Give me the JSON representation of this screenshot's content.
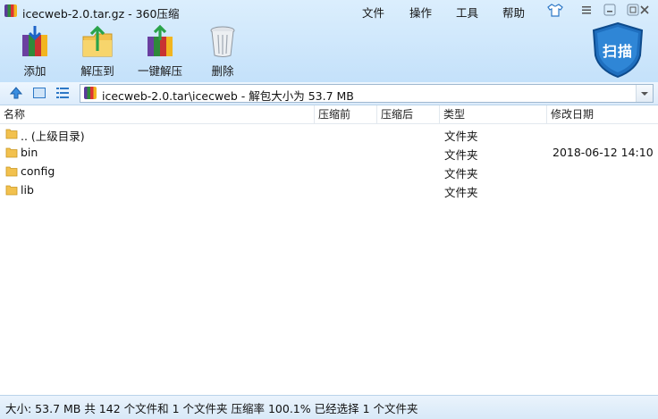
{
  "window": {
    "title": "icecweb-2.0.tar.gz - 360压缩",
    "menu": [
      "文件",
      "操作",
      "工具",
      "帮助"
    ]
  },
  "toolbar": {
    "add_label": "添加",
    "extract_to_label": "解压到",
    "one_click_extract_label": "一键解压",
    "delete_label": "删除",
    "scan_label": "扫描"
  },
  "address": {
    "path": "icecweb-2.0.tar\\icecweb - 解包大小为 53.7 MB"
  },
  "columns": [
    "名称",
    "压缩前",
    "压缩后",
    "类型",
    "修改日期"
  ],
  "rows": [
    {
      "name": ".. (上级目录)",
      "type": "文件夹",
      "modified": ""
    },
    {
      "name": "bin",
      "type": "文件夹",
      "modified": "2018-06-12 14:10"
    },
    {
      "name": "config",
      "type": "文件夹",
      "modified": ""
    },
    {
      "name": "lib",
      "type": "文件夹",
      "modified": ""
    }
  ],
  "status": {
    "text": "大小: 53.7 MB 共 142 个文件和 1 个文件夹 压缩率 100.1% 已经选择 1 个文件夹"
  },
  "colors": {
    "toolbar_bg": "#d2e9fc",
    "folder": "#f2c14e",
    "scan_shield": "#1f6fbf"
  }
}
